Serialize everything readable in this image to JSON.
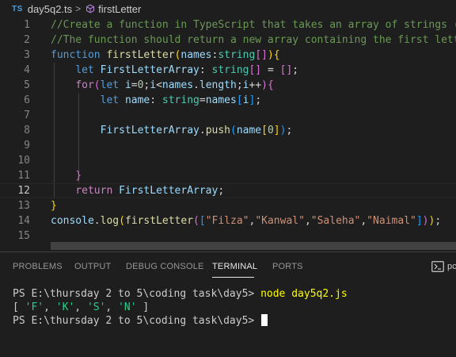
{
  "breadcrumb": {
    "lang_badge": "TS",
    "file": "day5q2.ts",
    "separator": ">",
    "symbol_icon": "symbol-method-icon",
    "symbol": "firstLetter"
  },
  "editor": {
    "active_line": "12",
    "lines": [
      {
        "n": "1",
        "tokens": [
          {
            "t": "//Create a function in TypeScript that takes an array of strings (n",
            "c": "comment"
          }
        ]
      },
      {
        "n": "2",
        "tokens": [
          {
            "t": "//The function should return a new array containing the first lette",
            "c": "comment"
          }
        ]
      },
      {
        "n": "3",
        "tokens": [
          {
            "t": "function",
            "c": "kw"
          },
          {
            "t": " ",
            "c": "punc"
          },
          {
            "t": "firstLetter",
            "c": "fn"
          },
          {
            "t": "(",
            "c": "b1"
          },
          {
            "t": "names",
            "c": "var"
          },
          {
            "t": ":",
            "c": "punc"
          },
          {
            "t": "string",
            "c": "type"
          },
          {
            "t": "[]",
            "c": "b2"
          },
          {
            "t": ")",
            "c": "b1"
          },
          {
            "t": "{",
            "c": "b1"
          }
        ]
      },
      {
        "n": "4",
        "tokens": [
          {
            "t": "    ",
            "c": "punc"
          },
          {
            "t": "let",
            "c": "kw"
          },
          {
            "t": " ",
            "c": "punc"
          },
          {
            "t": "FirstLetterArray",
            "c": "var"
          },
          {
            "t": ": ",
            "c": "punc"
          },
          {
            "t": "string",
            "c": "type"
          },
          {
            "t": "[]",
            "c": "b2"
          },
          {
            "t": " = ",
            "c": "punc"
          },
          {
            "t": "[]",
            "c": "b2"
          },
          {
            "t": ";",
            "c": "punc"
          }
        ]
      },
      {
        "n": "5",
        "tokens": [
          {
            "t": "    ",
            "c": "punc"
          },
          {
            "t": "for",
            "c": "ctl"
          },
          {
            "t": "(",
            "c": "b2"
          },
          {
            "t": "let",
            "c": "kw"
          },
          {
            "t": " ",
            "c": "punc"
          },
          {
            "t": "i",
            "c": "var"
          },
          {
            "t": "=",
            "c": "punc"
          },
          {
            "t": "0",
            "c": "num"
          },
          {
            "t": ";",
            "c": "punc"
          },
          {
            "t": "i",
            "c": "var"
          },
          {
            "t": "<",
            "c": "punc"
          },
          {
            "t": "names",
            "c": "var"
          },
          {
            "t": ".",
            "c": "punc"
          },
          {
            "t": "length",
            "c": "var"
          },
          {
            "t": ";",
            "c": "punc"
          },
          {
            "t": "i",
            "c": "var"
          },
          {
            "t": "++",
            "c": "punc"
          },
          {
            "t": ")",
            "c": "b2"
          },
          {
            "t": "{",
            "c": "b2"
          }
        ]
      },
      {
        "n": "6",
        "tokens": [
          {
            "t": "        ",
            "c": "punc"
          },
          {
            "t": "let",
            "c": "kw"
          },
          {
            "t": " ",
            "c": "punc"
          },
          {
            "t": "name",
            "c": "var"
          },
          {
            "t": ": ",
            "c": "punc"
          },
          {
            "t": "string",
            "c": "type"
          },
          {
            "t": "=",
            "c": "punc"
          },
          {
            "t": "names",
            "c": "var"
          },
          {
            "t": "[",
            "c": "b3"
          },
          {
            "t": "i",
            "c": "var"
          },
          {
            "t": "]",
            "c": "b3"
          },
          {
            "t": ";",
            "c": "punc"
          }
        ]
      },
      {
        "n": "7",
        "tokens": []
      },
      {
        "n": "8",
        "tokens": [
          {
            "t": "        ",
            "c": "punc"
          },
          {
            "t": "FirstLetterArray",
            "c": "var"
          },
          {
            "t": ".",
            "c": "punc"
          },
          {
            "t": "push",
            "c": "fn"
          },
          {
            "t": "(",
            "c": "b3"
          },
          {
            "t": "name",
            "c": "var"
          },
          {
            "t": "[",
            "c": "b1"
          },
          {
            "t": "0",
            "c": "num"
          },
          {
            "t": "]",
            "c": "b1"
          },
          {
            "t": ")",
            "c": "b3"
          },
          {
            "t": ";",
            "c": "punc"
          }
        ]
      },
      {
        "n": "9",
        "tokens": []
      },
      {
        "n": "10",
        "tokens": []
      },
      {
        "n": "11",
        "tokens": [
          {
            "t": "    ",
            "c": "punc"
          },
          {
            "t": "}",
            "c": "b2"
          }
        ]
      },
      {
        "n": "12",
        "tokens": [
          {
            "t": "    ",
            "c": "punc"
          },
          {
            "t": "return",
            "c": "ctl"
          },
          {
            "t": " ",
            "c": "punc"
          },
          {
            "t": "FirstLetterArray",
            "c": "var"
          },
          {
            "t": ";",
            "c": "punc"
          }
        ]
      },
      {
        "n": "13",
        "tokens": [
          {
            "t": "}",
            "c": "b1"
          }
        ]
      },
      {
        "n": "14",
        "tokens": [
          {
            "t": "console",
            "c": "var"
          },
          {
            "t": ".",
            "c": "punc"
          },
          {
            "t": "log",
            "c": "fn"
          },
          {
            "t": "(",
            "c": "b1"
          },
          {
            "t": "firstLetter",
            "c": "fn"
          },
          {
            "t": "(",
            "c": "b2"
          },
          {
            "t": "[",
            "c": "b3"
          },
          {
            "t": "\"Filza\"",
            "c": "str"
          },
          {
            "t": ",",
            "c": "punc"
          },
          {
            "t": "\"Kanwal\"",
            "c": "str"
          },
          {
            "t": ",",
            "c": "punc"
          },
          {
            "t": "\"Saleha\"",
            "c": "str"
          },
          {
            "t": ",",
            "c": "punc"
          },
          {
            "t": "\"Naimal\"",
            "c": "str"
          },
          {
            "t": "]",
            "c": "b3"
          },
          {
            "t": ")",
            "c": "b2"
          },
          {
            "t": ")",
            "c": "b1"
          },
          {
            "t": ";",
            "c": "punc"
          }
        ]
      },
      {
        "n": "15",
        "tokens": []
      }
    ]
  },
  "panel": {
    "tabs": [
      {
        "label": "PROBLEMS"
      },
      {
        "label": "OUTPUT"
      },
      {
        "label": "DEBUG CONSOLE"
      },
      {
        "label": "TERMINAL",
        "active": true
      },
      {
        "label": "PORTS"
      }
    ],
    "terminal_icon": "terminal-powershell-icon",
    "terminal_icon_label": "pc"
  },
  "terminal": {
    "prompt1": "PS E:\\thursday 2 to 5\\coding task\\day5> ",
    "command": "node day5q2.js",
    "output_open": "[ ",
    "output_items": [
      "'F'",
      "'K'",
      "'S'",
      "'N'"
    ],
    "output_sep": ", ",
    "output_close": " ]",
    "prompt2": "PS E:\\thursday 2 to 5\\coding task\\day5> "
  },
  "colors": {
    "background": "#1e1e1e",
    "comment": "#6a9955",
    "keyword": "#569cd6",
    "control": "#c586c0",
    "function": "#dcdcaa",
    "variable": "#9cdcfe",
    "type": "#4ec9b0",
    "string": "#ce9178",
    "number": "#b5cea8",
    "command": "#ffff00",
    "terminal_string": "#23d18b"
  }
}
